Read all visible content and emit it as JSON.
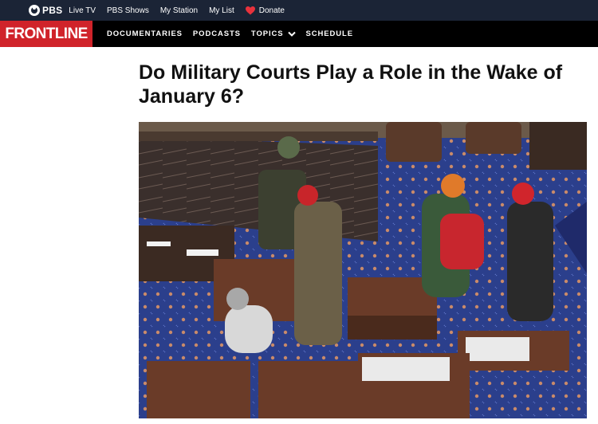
{
  "pbs_bar": {
    "logo_text": "PBS",
    "links": [
      "Live TV",
      "PBS Shows",
      "My Station",
      "My List"
    ],
    "donate_label": "Donate",
    "donate_color": "#e8323c"
  },
  "frontline_bar": {
    "logo_text": "FRONTLINE",
    "brand_color": "#d0232a",
    "nav": [
      "DOCUMENTARIES",
      "PODCASTS",
      "TOPICS",
      "SCHEDULE"
    ]
  },
  "article": {
    "title": "Do Military Courts Play a Role in the Wake of January 6?"
  },
  "icons": {
    "pbs": "pbs-logo-icon",
    "donate": "heart-icon",
    "topics": "chevron-down-icon"
  }
}
